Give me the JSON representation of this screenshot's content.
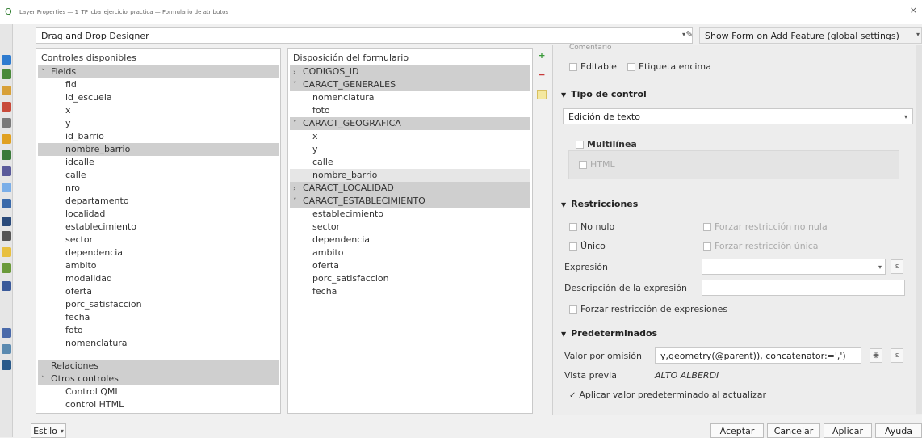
{
  "window": {
    "title": "Layer Properties — 1_TP_cba_ejercicio_practica — Formulario de atributos",
    "close_label": "×"
  },
  "top": {
    "designer_value": "Drag and Drop Designer",
    "show_form_value": "Show Form on Add Feature (global settings)"
  },
  "left_panel": {
    "title": "Controles disponibles",
    "fields_label": "Fields",
    "fields": [
      "fid",
      "id_escuela",
      "x",
      "y",
      "id_barrio",
      "nombre_barrio",
      "idcalle",
      "calle",
      "nro",
      "departamento",
      "localidad",
      "establecimiento",
      "sector",
      "dependencia",
      "ambito",
      "modalidad",
      "oferta",
      "porc_satisfaccion",
      "fecha",
      "foto",
      "nomenclatura"
    ],
    "relaciones_label": "Relaciones",
    "otros_label": "Otros controles",
    "otros": [
      "Control QML",
      "control HTML"
    ]
  },
  "middle_panel": {
    "title": "Disposición del formulario",
    "groups": [
      {
        "label": "CODIGOS_ID",
        "collapsed": true,
        "children": []
      },
      {
        "label": "CARACT_GENERALES",
        "collapsed": false,
        "children": [
          "nomenclatura",
          "foto"
        ]
      },
      {
        "label": "CARACT_GEOGRAFICA",
        "collapsed": false,
        "children": [
          "x",
          "y",
          "calle",
          "nombre_barrio"
        ]
      },
      {
        "label": "CARACT_LOCALIDAD",
        "collapsed": true,
        "children": []
      },
      {
        "label": "CARACT_ESTABLECIMIENTO",
        "collapsed": false,
        "children": [
          "establecimiento",
          "sector",
          "dependencia",
          "ambito",
          "oferta",
          "porc_satisfaccion",
          "fecha"
        ]
      }
    ]
  },
  "right_panel": {
    "cut_label": "Comentario",
    "editable_label": "Editable",
    "etiqueta_label": "Etiqueta encima",
    "tipo_control_title": "Tipo de control",
    "tipo_control_value": "Edición de texto",
    "multilinea_label": "Multilínea",
    "html_label": "HTML",
    "restricciones_title": "Restricciones",
    "no_nulo_label": "No nulo",
    "forzar_no_nula_label": "Forzar restricción no nula",
    "unico_label": "Único",
    "forzar_unica_label": "Forzar restricción única",
    "expresion_label": "Expresión",
    "descripcion_label": "Descripción de la expresión",
    "forzar_expresiones_label": "Forzar restricción de expresiones",
    "predeterminados_title": "Predeterminados",
    "valor_omision_label": "Valor por omisión",
    "valor_omision_value": "y,geometry(@parent)),  concatenator:=',')",
    "vista_previa_label": "Vista previa",
    "vista_previa_value": "ALTO ALBERDI",
    "aplicar_actualizar_label": "Aplicar valor predeterminado al actualizar"
  },
  "bottom": {
    "estilo_label": "Estilo",
    "aceptar_label": "Aceptar",
    "cancelar_label": "Cancelar",
    "aplicar_label": "Aplicar",
    "ayuda_label": "Ayuda"
  }
}
